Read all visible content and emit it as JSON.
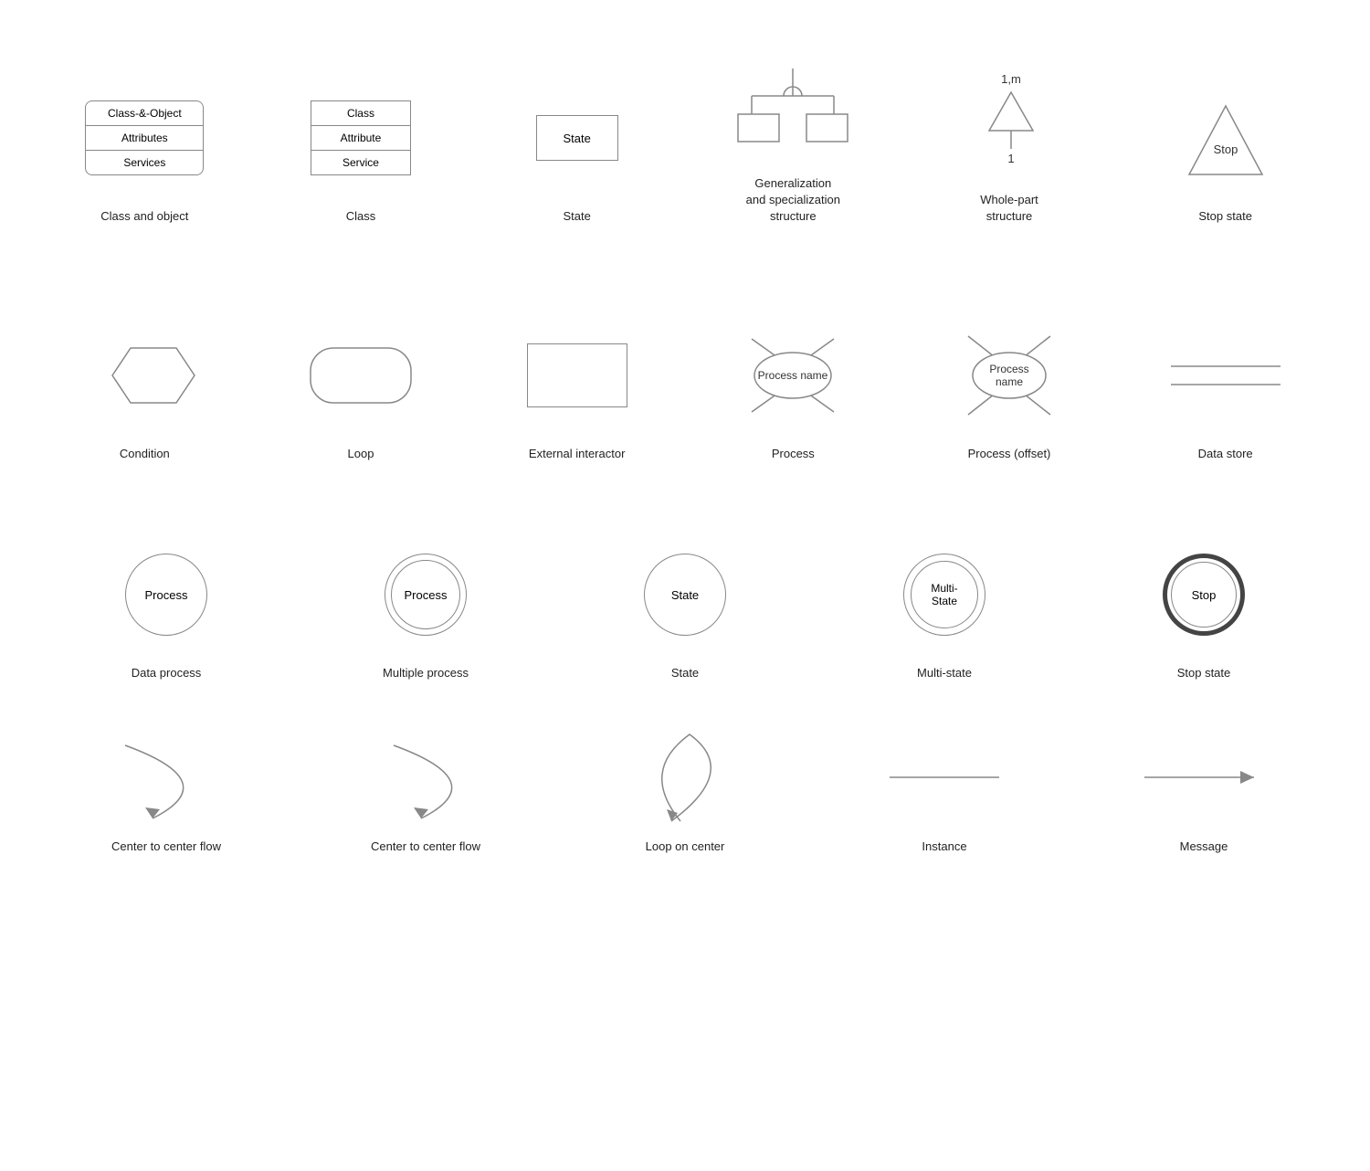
{
  "rows": [
    {
      "id": "row1",
      "cells": [
        {
          "id": "class-object",
          "label": "Class and object"
        },
        {
          "id": "class",
          "label": "Class"
        },
        {
          "id": "state-box",
          "label": "State"
        },
        {
          "id": "generalization",
          "label": "Generalization\nand specialization\nstructure"
        },
        {
          "id": "whole-part",
          "label": "Whole-part\nstructure"
        },
        {
          "id": "stop-triangle",
          "label": "Stop state"
        }
      ]
    },
    {
      "id": "row2",
      "cells": [
        {
          "id": "condition",
          "label": "Condition"
        },
        {
          "id": "loop",
          "label": "Loop"
        },
        {
          "id": "ext-interactor",
          "label": "External interactor"
        },
        {
          "id": "process",
          "label": "Process"
        },
        {
          "id": "process-offset",
          "label": "Process (offset)"
        },
        {
          "id": "data-store",
          "label": "Data store"
        }
      ]
    },
    {
      "id": "row3",
      "cells": [
        {
          "id": "data-process",
          "label": "Data process",
          "text": "Process"
        },
        {
          "id": "multiple-process",
          "label": "Multiple process",
          "text": "Process"
        },
        {
          "id": "state-circle",
          "label": "State",
          "text": "State"
        },
        {
          "id": "multi-state",
          "label": "Multi-state",
          "text": "Multi-\nState"
        },
        {
          "id": "stop-state-circle",
          "label": "Stop state",
          "text": "Stop"
        }
      ]
    }
  ],
  "row4": [
    {
      "id": "center-flow-1",
      "label": "Center to center flow"
    },
    {
      "id": "center-flow-2",
      "label": "Center to center flow"
    },
    {
      "id": "loop-center",
      "label": "Loop on center"
    },
    {
      "id": "instance",
      "label": "Instance"
    },
    {
      "id": "message",
      "label": "Message"
    }
  ],
  "shapes": {
    "class-object": {
      "name": "Class-&-Object",
      "row1": "Attributes",
      "row2": "Services"
    },
    "class": {
      "row1": "Class",
      "row2": "Attribute",
      "row3": "Service"
    },
    "state-box": {
      "text": "State"
    },
    "process": {
      "text": "Process name"
    },
    "process-offset": {
      "text": "Process\nname"
    },
    "stop-triangle": {
      "text": "Stop"
    }
  }
}
